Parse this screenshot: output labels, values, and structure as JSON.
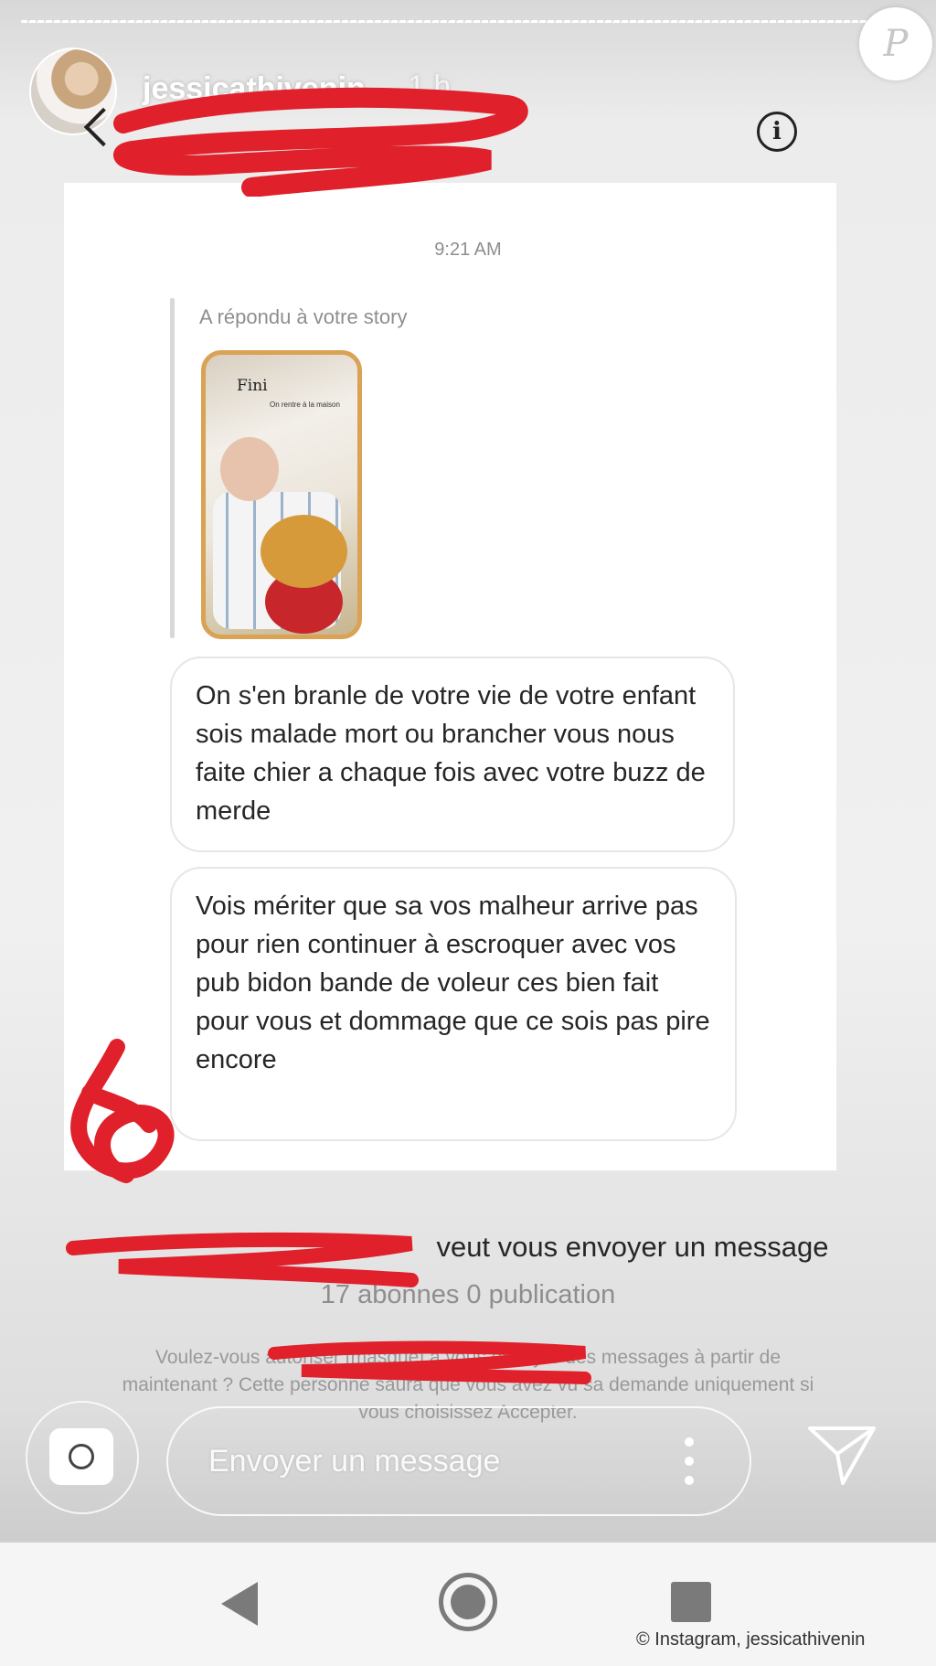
{
  "story": {
    "username": "jessicathivenin",
    "time_ago": "1 h",
    "watermark": "P"
  },
  "header": {
    "back_icon": "chevron-left-icon",
    "info_icon": "info-icon",
    "info_glyph": "i"
  },
  "conversation": {
    "timestamp": "9:21 AM",
    "reply_label": "A répondu à votre story",
    "story_thumb_caption": "Fini",
    "story_thumb_subcaption": "On rentre à la maison",
    "messages": [
      "On s'en branle de votre vie de votre enfant sois malade mort ou brancher vous nous faite chier a chaque fois avec votre buzz de merde",
      "Vois mériter que sa vos malheur arrive pas pour rien continuer à escroquer avec vos pub bidon bande de voleur ces bien fait pour vous et dommage que ce sois pas pire encore"
    ]
  },
  "request": {
    "title_suffix": "veut vous envoyer un message",
    "stats": "17 abonnes 0 publication",
    "description": "Voulez-vous autoriser [masqué] à vous envoyer des messages à partir de maintenant ? Cette personne saura que vous avez vu sa demande uniquement si vous choisissez Accepter."
  },
  "composer": {
    "placeholder": "Envoyer un message",
    "camera_icon": "camera-icon",
    "more_icon": "more-vertical-icon",
    "send_icon": "send-icon"
  },
  "android_nav": {
    "back": "nav-back-icon",
    "home": "nav-home-icon",
    "recent": "nav-recent-icon"
  },
  "credit": "© Instagram, jessicathivenin",
  "colors": {
    "redaction": "#e0202a",
    "thumb_border": "#d9a254",
    "text_primary": "#262626",
    "text_secondary": "#8e8e8e"
  }
}
